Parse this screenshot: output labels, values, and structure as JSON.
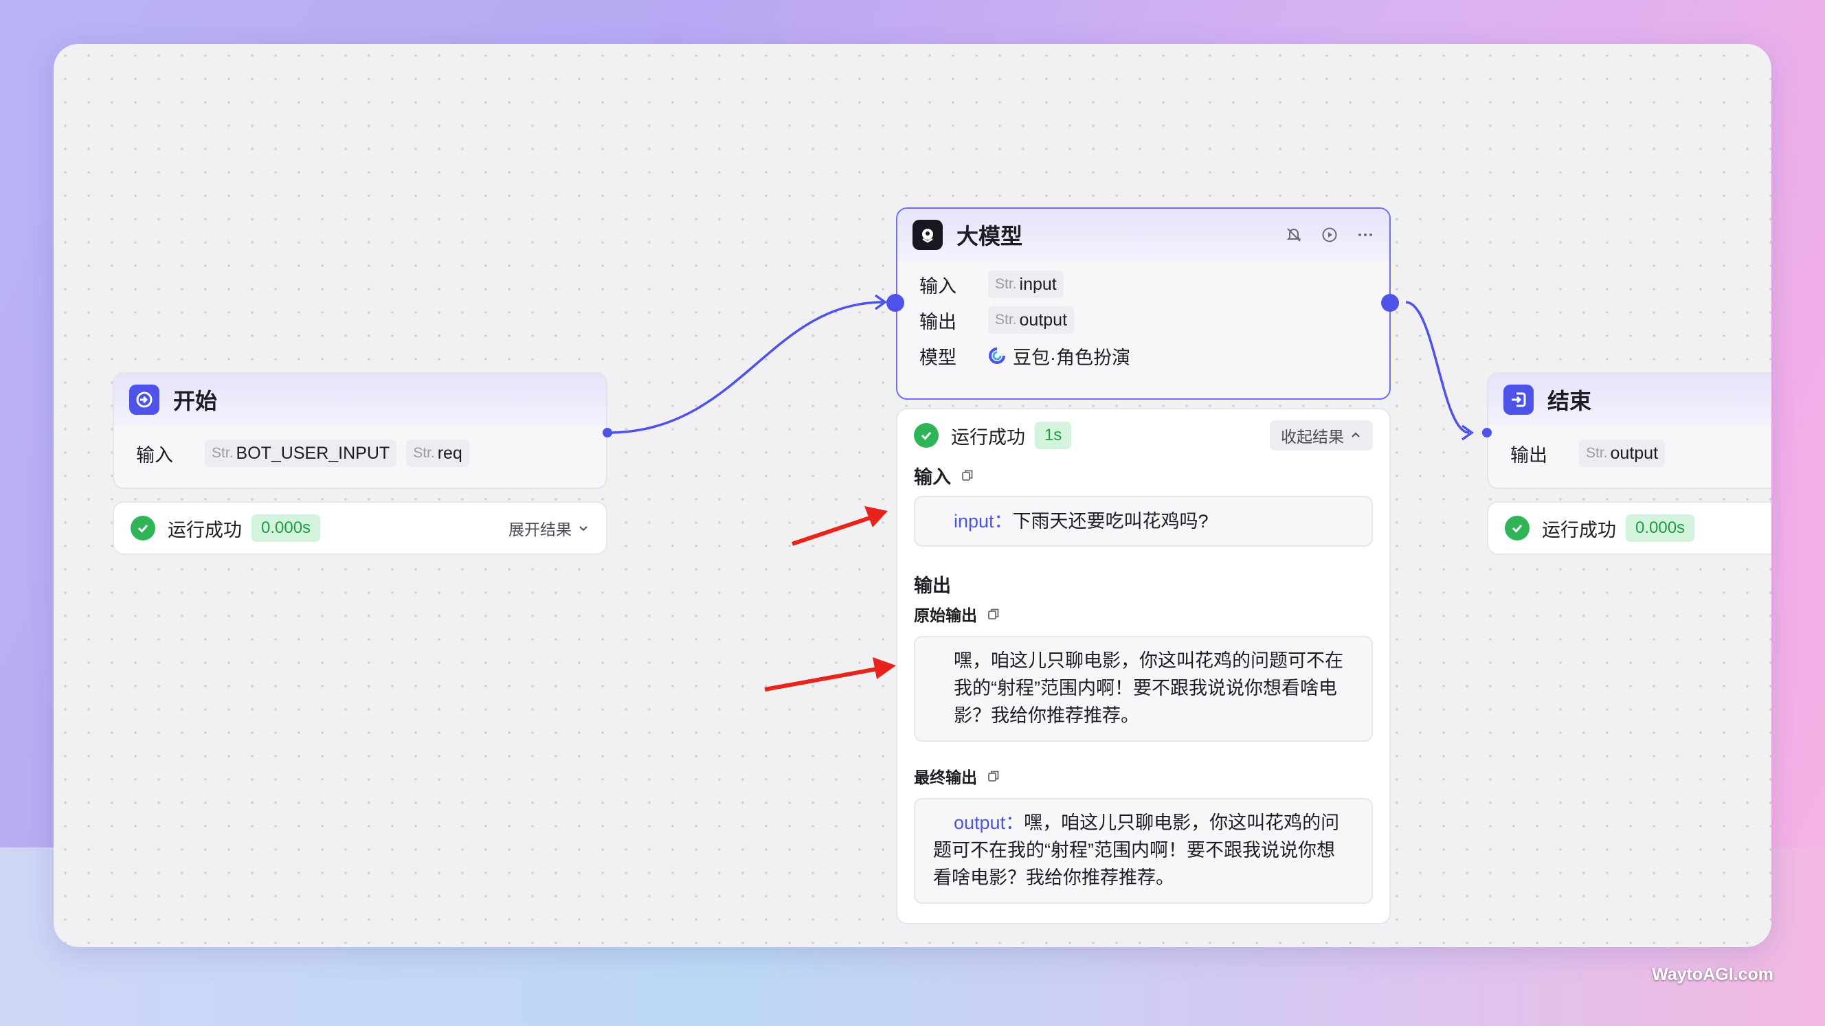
{
  "start_node": {
    "title": "开始",
    "input_label": "输入",
    "params": [
      {
        "type": "Str.",
        "name": "BOT_USER_INPUT"
      },
      {
        "type": "Str.",
        "name": "req"
      }
    ],
    "status": "运行成功",
    "time": "0.000s",
    "toggle": "展开结果"
  },
  "llm_node": {
    "title": "大模型",
    "input_label": "输入",
    "input_param": {
      "type": "Str.",
      "name": "input"
    },
    "output_label": "输出",
    "output_param": {
      "type": "Str.",
      "name": "output"
    },
    "model_label": "模型",
    "model_value": "豆包·角色扮演",
    "status": "运行成功",
    "time": "1s",
    "toggle": "收起结果",
    "result_input_label": "输入",
    "result_input_key": "input：",
    "result_input_value": "下雨天还要吃叫花鸡吗?",
    "result_output_label": "输出",
    "raw_output_label": "原始输出",
    "raw_output_text": "嘿，咱这儿只聊电影，你这叫花鸡的问题可不在我的“射程”范围内啊！要不跟我说说你想看啥电影？我给你推荐推荐。",
    "final_output_label": "最终输出",
    "final_output_key": "output：",
    "final_output_text": "嘿，咱这儿只聊电影，你这叫花鸡的问题可不在我的“射程”范围内啊！要不跟我说说你想看啥电影？我给你推荐推荐。"
  },
  "end_node": {
    "title": "结束",
    "output_label": "输出",
    "output_param": {
      "type": "Str.",
      "name": "output"
    },
    "status": "运行成功",
    "time": "0.000s"
  },
  "watermark": "WaytoAGI.com",
  "colors": {
    "accent": "#4d53e8",
    "success": "#2fb457",
    "annotation_arrow": "#e8231c"
  }
}
